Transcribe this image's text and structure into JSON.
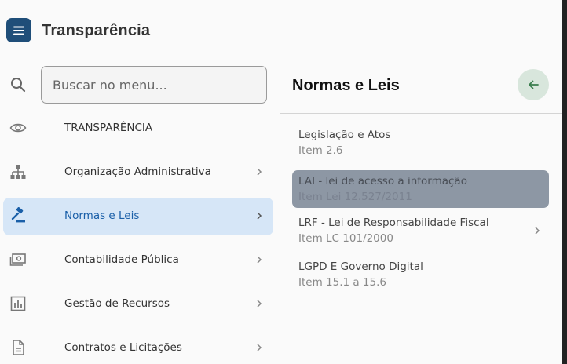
{
  "header": {
    "title": "Transparência",
    "menu_icon": "hamburger-menu-icon",
    "menu_color": "#1f4e79"
  },
  "search": {
    "placeholder": "Buscar no menu..."
  },
  "nav": {
    "items": [
      {
        "label": "TRANSPARÊNCIA",
        "icon": "eye-icon",
        "has_chevron": false
      },
      {
        "label": "Organização Administrativa",
        "icon": "org-chart-icon",
        "has_chevron": true
      },
      {
        "label": "Normas e Leis",
        "icon": "gavel-icon",
        "has_chevron": true,
        "active": true
      },
      {
        "label": "Contabilidade Pública",
        "icon": "money-icon",
        "has_chevron": true
      },
      {
        "label": "Gestão de Recursos",
        "icon": "bar-chart-icon",
        "has_chevron": true
      },
      {
        "label": "Contratos e Licitações",
        "icon": "document-icon",
        "has_chevron": true
      }
    ],
    "active_color": "#1a5fa8",
    "active_bg": "#d6e6f7"
  },
  "submenu": {
    "title": "Normas e Leis",
    "back_icon": "arrow-left-icon",
    "items": [
      {
        "label": "Legislação e Atos",
        "detail": "Item 2.6",
        "has_chevron": false
      },
      {
        "label": "LAI - lei de acesso a informação",
        "detail": "Item Lei 12.527/2011",
        "has_chevron": false,
        "highlighted": true
      },
      {
        "label": "LRF - Lei de Responsabilidade Fiscal",
        "detail": "Item LC 101/2000",
        "has_chevron": true
      },
      {
        "label": "LGPD E Governo Digital",
        "detail": "Item 15.1 a 15.6",
        "has_chevron": false
      }
    ]
  }
}
